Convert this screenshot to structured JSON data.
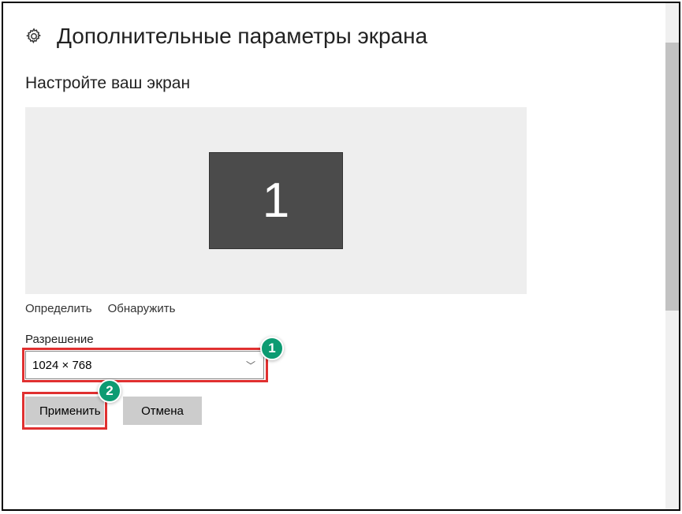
{
  "header": {
    "title": "Дополнительные параметры экрана"
  },
  "section": {
    "heading": "Настройте ваш экран",
    "monitorNumber": "1",
    "identify": "Определить",
    "detect": "Обнаружить"
  },
  "resolution": {
    "label": "Разрешение",
    "value": "1024 × 768"
  },
  "buttons": {
    "apply": "Применить",
    "cancel": "Отмена"
  },
  "annotations": {
    "callout1": "1",
    "callout2": "2"
  }
}
